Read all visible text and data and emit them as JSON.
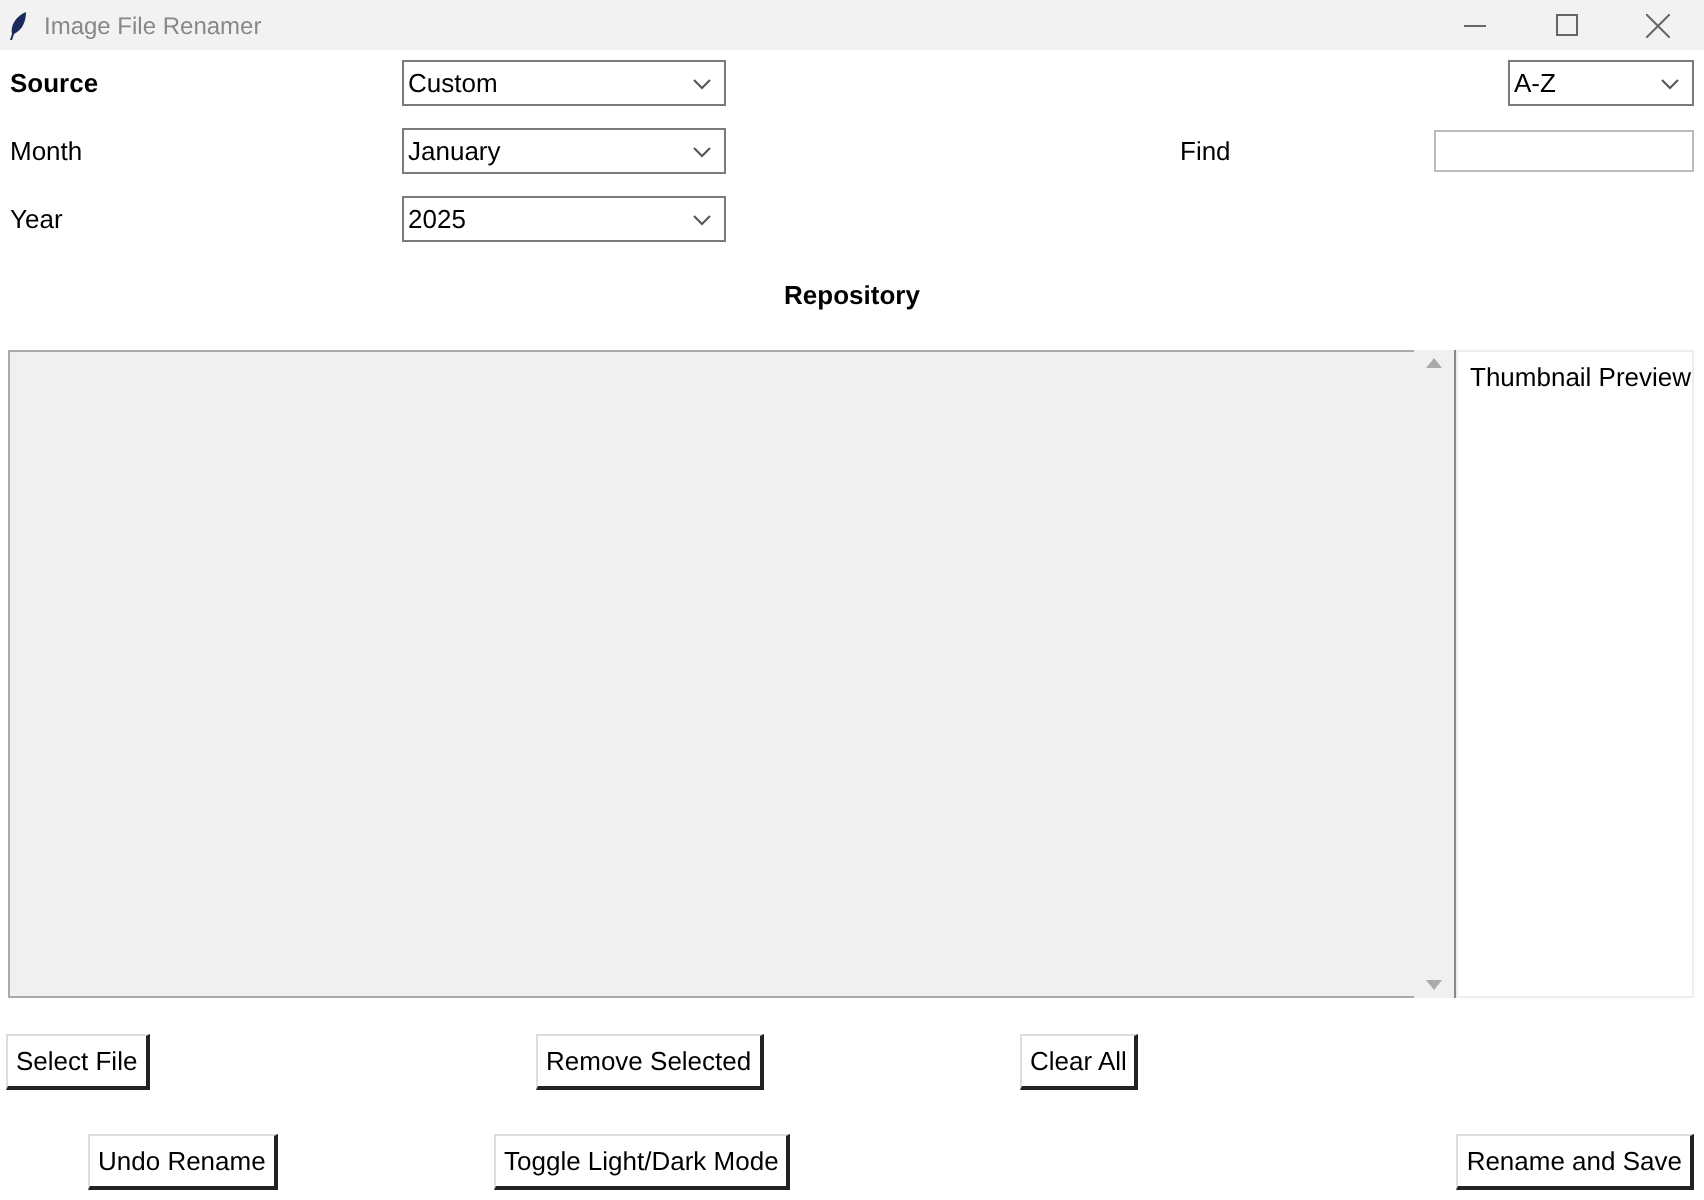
{
  "window": {
    "title": "Image File Renamer"
  },
  "fields": [
    {
      "label": "Source",
      "bold": true,
      "value": "Custom"
    },
    {
      "label": "Month",
      "bold": false,
      "value": "January"
    },
    {
      "label": "Year",
      "bold": false,
      "value": "2025"
    }
  ],
  "sort": {
    "value": "A-Z"
  },
  "find": {
    "label": "Find"
  },
  "repository": {
    "title": "Repository"
  },
  "preview": {
    "label": "Thumbnail Preview"
  },
  "buttons_row_1": [
    "Select File",
    "Remove Selected",
    "Clear All"
  ],
  "buttons_row_2": [
    "Undo Rename",
    "Toggle Light/Dark Mode",
    "Rename and Save"
  ]
}
